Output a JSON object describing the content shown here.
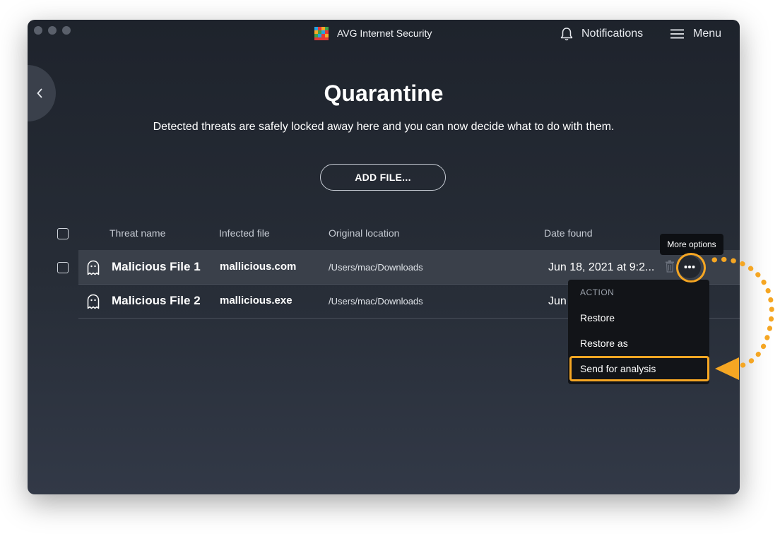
{
  "app": {
    "title": "AVG Internet Security"
  },
  "toolbar": {
    "notifications_label": "Notifications",
    "menu_label": "Menu"
  },
  "page": {
    "title": "Quarantine",
    "subtitle": "Detected threats are safely locked away here and you can now decide what to do with them.",
    "add_file_label": "ADD FILE..."
  },
  "table": {
    "columns": [
      "Threat name",
      "Infected file",
      "Original location",
      "Date found"
    ],
    "rows": [
      {
        "threat": "Malicious File 1",
        "file": "mallicious.com",
        "location": "/Users/mac/Downloads",
        "date": "Jun 18, 2021 at 9:2...",
        "selected": true
      },
      {
        "threat": "Malicious File 2",
        "file": "mallicious.exe",
        "location": "/Users/mac/Downloads",
        "date": "Jun",
        "selected": false
      }
    ]
  },
  "tooltip": {
    "more_options": "More options"
  },
  "dropdown": {
    "header": "ACTION",
    "items": [
      "Restore",
      "Restore as",
      "Send for analysis"
    ]
  },
  "colors": {
    "accent": "#f5a623",
    "window_bg": "#272d37",
    "row_selected": "#3a404a"
  },
  "icons": [
    "ghost-icon",
    "trash-icon",
    "more-dots-icon",
    "bell-icon",
    "hamburger-icon",
    "chevron-left-icon"
  ]
}
